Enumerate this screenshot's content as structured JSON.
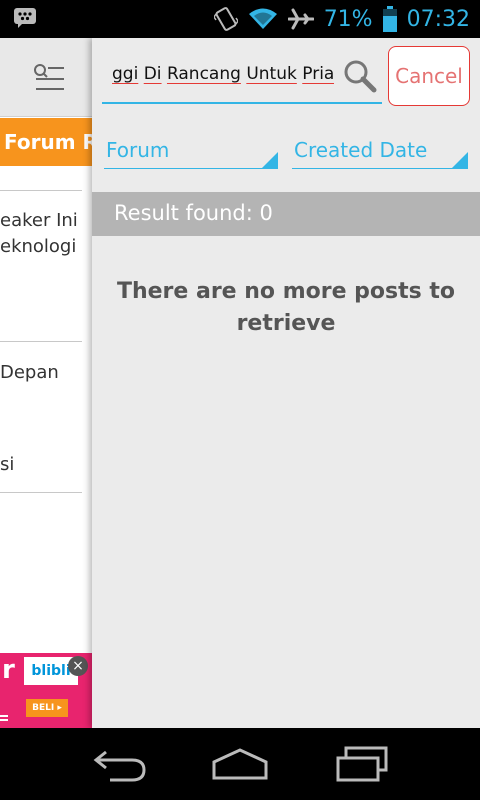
{
  "status_bar": {
    "battery_percent": "71%",
    "time": "07:32",
    "icons": [
      "bbm-icon",
      "vibrate-icon",
      "wifi-icon",
      "airplane-icon",
      "battery-icon"
    ]
  },
  "background_app": {
    "tab_label": "Forum R",
    "items": [
      {
        "line1": "eaker Ini",
        "line2": "eknologi"
      },
      {
        "line1": "Depan",
        "line2": ""
      },
      {
        "line1": "si",
        "line2": ""
      }
    ],
    "ad": {
      "brand": "blibli",
      "letter": "r",
      "buy_label": "BELI ▸"
    }
  },
  "search": {
    "query": "ggi Di Rancang Untuk Pria?",
    "query_words": [
      "ggi",
      "Di",
      "Rancang",
      "Untuk",
      "Pria?"
    ],
    "cancel_label": "Cancel"
  },
  "filters": {
    "forum_label": "Forum",
    "date_label": "Created Date"
  },
  "results": {
    "found_text": "Result found: 0",
    "empty_message": "There are no more posts to retrieve"
  },
  "colors": {
    "accent": "#33b5e5",
    "orange_tab": "#f7941d",
    "cancel": "#e53935",
    "result_bar": "#b4b4b4"
  }
}
